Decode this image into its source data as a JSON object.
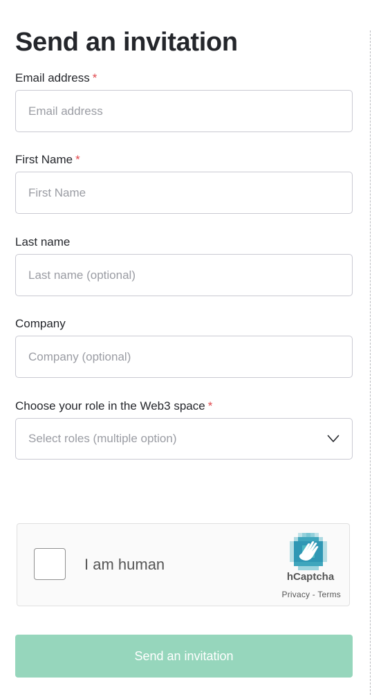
{
  "form": {
    "title": "Send an invitation",
    "required_marker": "*",
    "fields": {
      "email": {
        "label": "Email address",
        "placeholder": "Email address",
        "value": ""
      },
      "first_name": {
        "label": "First Name",
        "placeholder": "First Name",
        "value": ""
      },
      "last_name": {
        "label": "Last name",
        "placeholder": "Last name (optional)",
        "value": ""
      },
      "company": {
        "label": "Company",
        "placeholder": "Company (optional)",
        "value": ""
      },
      "role": {
        "label": "Choose your role in the Web3 space",
        "placeholder": "Select roles (multiple option)",
        "icon": "chevron-down-icon"
      }
    },
    "submit_label": "Send an invitation"
  },
  "captcha": {
    "checkbox_label": "I am human",
    "brand": "hCaptcha",
    "privacy_label": "Privacy",
    "separator": " - ",
    "terms_label": "Terms",
    "logo_icon": "hcaptcha-hand-icon"
  },
  "colors": {
    "required": "#e0474c",
    "button_bg": "#96d6bc",
    "button_text": "#ffffff",
    "input_border": "#c9c9d2",
    "placeholder": "#9a9ca3",
    "hcaptcha_teal": "#4fb4c6"
  }
}
